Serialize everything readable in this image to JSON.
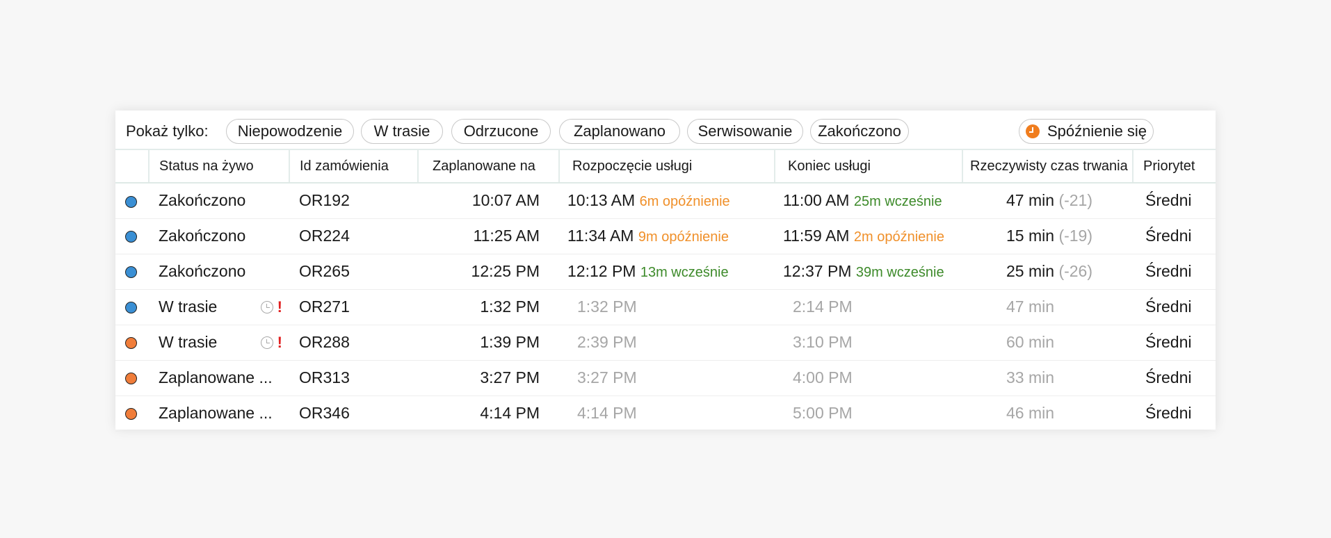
{
  "filters": {
    "label": "Pokaż tylko:",
    "pills": [
      "Niepowodzenie",
      "W trasie",
      "Odrzucone",
      "Zaplanowano",
      "Serwisowanie",
      "Zakończono"
    ],
    "late_pill": "Spóźnienie się"
  },
  "table": {
    "headers": {
      "status": "Status na żywo",
      "order_id": "Id zamówienia",
      "scheduled": "Zaplanowane na",
      "start": "Rozpoczęcie usługi",
      "end": "Koniec usługi",
      "duration": "Rzeczywisty czas trwania",
      "priority": "Priorytet"
    },
    "rows": [
      {
        "dot": "#3a8fd4",
        "status": "Zakończono",
        "flags": false,
        "order_id": "OR192",
        "scheduled": "10:07 AM",
        "start": "10:13 AM",
        "start_note": "6m opóźnienie",
        "start_note_kind": "late",
        "end": "11:00 AM",
        "end_note": "25m wcześnie",
        "end_note_kind": "early",
        "duration": "47 min",
        "delta": "(-21)",
        "priority": "Średni",
        "muted": false
      },
      {
        "dot": "#3a8fd4",
        "status": "Zakończono",
        "flags": false,
        "order_id": "OR224",
        "scheduled": "11:25 AM",
        "start": "11:34 AM",
        "start_note": "9m opóźnienie",
        "start_note_kind": "late",
        "end": "11:59 AM",
        "end_note": "2m opóźnienie",
        "end_note_kind": "late",
        "duration": "15 min",
        "delta": "(-19)",
        "priority": "Średni",
        "muted": false
      },
      {
        "dot": "#3a8fd4",
        "status": "Zakończono",
        "flags": false,
        "order_id": "OR265",
        "scheduled": "12:25 PM",
        "start": "12:12 PM",
        "start_note": "13m wcześnie",
        "start_note_kind": "early",
        "end": "12:37 PM",
        "end_note": "39m wcześnie",
        "end_note_kind": "early",
        "duration": "25 min",
        "delta": "(-26)",
        "priority": "Średni",
        "muted": false
      },
      {
        "dot": "#3a8fd4",
        "status": "W trasie",
        "flags": true,
        "order_id": "OR271",
        "scheduled": "1:32 PM",
        "start": "1:32 PM",
        "start_note": "",
        "start_note_kind": "",
        "end": "2:14 PM",
        "end_note": "",
        "end_note_kind": "",
        "duration": "47 min",
        "delta": "",
        "priority": "Średni",
        "muted": true
      },
      {
        "dot": "#f07d3a",
        "status": "W trasie",
        "flags": true,
        "order_id": "OR288",
        "scheduled": "1:39 PM",
        "start": "2:39 PM",
        "start_note": "",
        "start_note_kind": "",
        "end": "3:10 PM",
        "end_note": "",
        "end_note_kind": "",
        "duration": "60 min",
        "delta": "",
        "priority": "Średni",
        "muted": true
      },
      {
        "dot": "#f07d3a",
        "status": "Zaplanowane ...",
        "flags": false,
        "order_id": "OR313",
        "scheduled": "3:27 PM",
        "start": "3:27 PM",
        "start_note": "",
        "start_note_kind": "",
        "end": "4:00 PM",
        "end_note": "",
        "end_note_kind": "",
        "duration": "33 min",
        "delta": "",
        "priority": "Średni",
        "muted": true
      },
      {
        "dot": "#f07d3a",
        "status": "Zaplanowane ...",
        "flags": false,
        "order_id": "OR346",
        "scheduled": "4:14 PM",
        "start": "4:14 PM",
        "start_note": "",
        "start_note_kind": "",
        "end": "5:00 PM",
        "end_note": "",
        "end_note_kind": "",
        "duration": "46 min",
        "delta": "",
        "priority": "Średni",
        "muted": true
      }
    ]
  }
}
